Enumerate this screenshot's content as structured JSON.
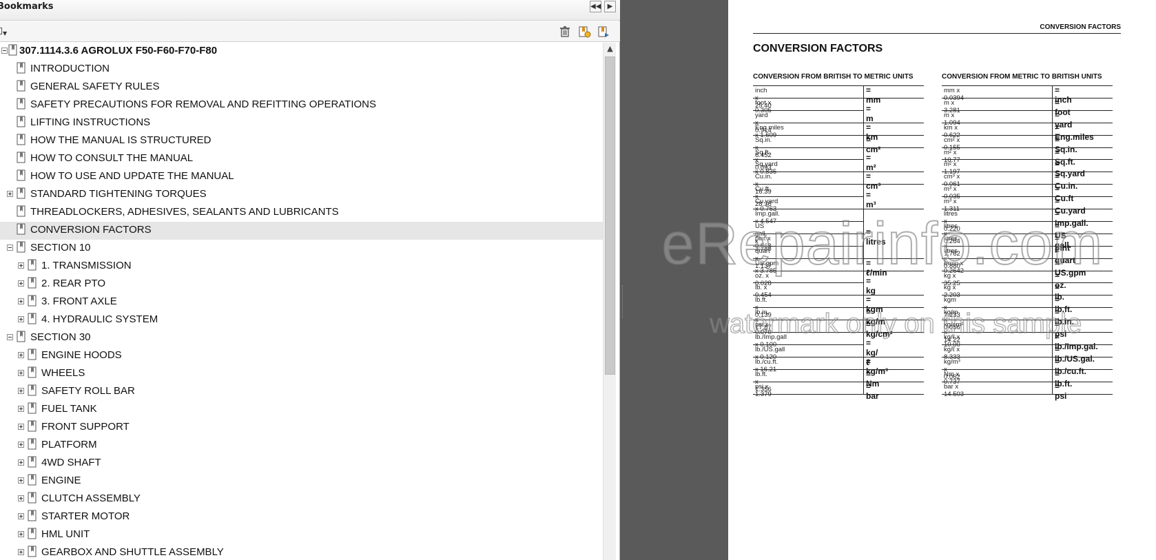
{
  "bookmarks_panel": {
    "title": "Bookmarks",
    "icons": {
      "collapse": "double-left-arrow-icon",
      "expand": "right-arrow-icon",
      "options": "options-dropdown-icon",
      "delete": "trash-icon",
      "new_bookmark": "new-bookmark-icon",
      "expand_bookmark": "expand-bookmark-icon"
    },
    "tree": [
      {
        "label": "307.1114.3.6 AGROLUX F50-F60-F70-F80",
        "level": 0,
        "expander": "minus",
        "bold": true
      },
      {
        "label": "INTRODUCTION",
        "level": 1,
        "expander": "none"
      },
      {
        "label": "GENERAL SAFETY RULES",
        "level": 1,
        "expander": "none"
      },
      {
        "label": "SAFETY PRECAUTIONS FOR REMOVAL AND REFITTING OPERATIONS",
        "level": 1,
        "expander": "none"
      },
      {
        "label": "LIFTING INSTRUCTIONS",
        "level": 1,
        "expander": "none"
      },
      {
        "label": "HOW THE MANUAL IS STRUCTURED",
        "level": 1,
        "expander": "none"
      },
      {
        "label": "HOW TO CONSULT THE MANUAL",
        "level": 1,
        "expander": "none"
      },
      {
        "label": "HOW TO USE AND UPDATE THE MANUAL",
        "level": 1,
        "expander": "none"
      },
      {
        "label": "STANDARD TIGHTENING TORQUES",
        "level": 1,
        "expander": "plus"
      },
      {
        "label": "THREADLOCKERS, ADHESIVES, SEALANTS AND LUBRICANTS",
        "level": 1,
        "expander": "none"
      },
      {
        "label": "CONVERSION FACTORS",
        "level": 1,
        "expander": "none",
        "selected": true
      },
      {
        "label": "SECTION 10",
        "level": 1,
        "expander": "minus"
      },
      {
        "label": "1. TRANSMISSION",
        "level": 2,
        "expander": "plus"
      },
      {
        "label": "2. REAR PTO",
        "level": 2,
        "expander": "plus"
      },
      {
        "label": "3. FRONT AXLE",
        "level": 2,
        "expander": "plus"
      },
      {
        "label": "4. HYDRAULIC SYSTEM",
        "level": 2,
        "expander": "plus"
      },
      {
        "label": "SECTION 30",
        "level": 1,
        "expander": "minus"
      },
      {
        "label": "ENGINE HOODS",
        "level": 2,
        "expander": "plus"
      },
      {
        "label": "WHEELS",
        "level": 2,
        "expander": "plus"
      },
      {
        "label": "SAFETY ROLL BAR",
        "level": 2,
        "expander": "plus"
      },
      {
        "label": "FUEL TANK",
        "level": 2,
        "expander": "plus"
      },
      {
        "label": "FRONT SUPPORT",
        "level": 2,
        "expander": "plus"
      },
      {
        "label": "PLATFORM",
        "level": 2,
        "expander": "plus"
      },
      {
        "label": "4WD SHAFT",
        "level": 2,
        "expander": "plus"
      },
      {
        "label": "ENGINE",
        "level": 2,
        "expander": "plus"
      },
      {
        "label": "CLUTCH ASSEMBLY",
        "level": 2,
        "expander": "plus"
      },
      {
        "label": "STARTER MOTOR",
        "level": 2,
        "expander": "plus"
      },
      {
        "label": "HML UNIT",
        "level": 2,
        "expander": "plus"
      },
      {
        "label": "GEARBOX AND SHUTTLE ASSEMBLY",
        "level": 2,
        "expander": "plus"
      }
    ]
  },
  "document": {
    "running_head": "CONVERSION FACTORS",
    "title": "CONVERSION FACTORS",
    "british_to_metric": {
      "heading": "CONVERSION FROM BRITISH TO METRIC UNITS",
      "rows": [
        "inch  x  25.40",
        "foot  x  0.305",
        "yard  x  0.914",
        "Eng.miles  x  1.609",
        "Sq.in.  x  6.452",
        "Sq.ft.  x  0.093",
        "Sq.yard  x  0.835",
        "Cu.in.  x  16.39",
        "Cu.ft.  x  28.36",
        "Cu.yard  x  0.763",
        "Imp.gall.  x  4.547",
        "US gall.  x  3.785",
        "pint  x  0.568",
        "quart  x  1.137",
        "US.gpm  x  3.785",
        "oz.  x  0.028",
        "lb.  x  0.454",
        "lb.ft.  x  0.139",
        "lb.in.  x  17.87",
        "psi  x  0.070",
        "lb./Imp.gall  x  0.100",
        "lb./US.gall  x  0.120",
        "lb./cu.ft.  x  16.21",
        "lb.ft.  x  1.356",
        "psi  x  1.379"
      ],
      "results": [
        {
          "text": "= mm",
          "start": 0,
          "span": 1
        },
        {
          "text": "= m",
          "start": 1,
          "span": 2
        },
        {
          "text": "= km",
          "start": 3,
          "span": 1
        },
        {
          "text": "= cm²",
          "start": 4,
          "span": 1
        },
        {
          "text": "= m²",
          "start": 5,
          "span": 2
        },
        {
          "text": "= cm³",
          "start": 7,
          "span": 1
        },
        {
          "text": "= m³",
          "start": 8,
          "span": 2
        },
        {
          "text": "= litres",
          "start": 10,
          "span": 4
        },
        {
          "text": "= ℓ/min",
          "start": 14,
          "span": 1
        },
        {
          "text": "= kg",
          "start": 15,
          "span": 2
        },
        {
          "text": "= kgm",
          "start": 17,
          "span": 1
        },
        {
          "text": "= kg/m",
          "start": 18,
          "span": 1
        },
        {
          "text": "= kg/cm²",
          "start": 19,
          "span": 1
        },
        {
          "text": "= kg/ℓ",
          "start": 20,
          "span": 2
        },
        {
          "text": "= kg/m³",
          "start": 22,
          "span": 1
        },
        {
          "text": "= Nm",
          "start": 23,
          "span": 1
        },
        {
          "text": "= bar",
          "start": 24,
          "span": 1
        }
      ]
    },
    "metric_to_british": {
      "heading": "CONVERSION FROM METRIC TO BRITISH UNITS",
      "rows": [
        "mm  x  0.0394",
        "m  x  3.281",
        "m  x  1.094",
        "km  x  0.622",
        "cm²  x  0.155",
        "m²  x  10.77",
        "m²  x  1.197",
        "cm³  x  0.061",
        "m³  x  0.035",
        "m³  x  1.311",
        "litres  x  0.220",
        "litres  x  0.264",
        "litres  x  1.762",
        "litres  x  0.880",
        "ℓ/min  x  0.2642",
        "kg  x  35.25",
        "kg  x  2.203",
        "kgm  x  7.233",
        "kg/m  x  0.056",
        "kg/cm²  x  14.22",
        "kg/ℓ  x  10.00",
        "kg/ℓ  x  8.333",
        "kg/m³  x  0.062",
        "Nm  x  0.737",
        "bar  x  14.503"
      ],
      "results": [
        "= inch",
        "= foot",
        "= yard",
        "= Eng.miles",
        "= Sq.in.",
        "= Sq.ft.",
        "= Sq.yard",
        "= Cu.in.",
        "= Cu.ft",
        "= Cu.yard",
        "= Imp.gall.",
        "= US gall.",
        "= pint",
        "= quart",
        "= US.gpm",
        "= oz.",
        "= lb.",
        "= lb.ft.",
        "= lb.in.",
        "= psi",
        "= lb./Imp.gal.",
        "= lb./US.gal.",
        "= lb./cu.ft.",
        "= lb.ft.",
        "= psi"
      ]
    }
  },
  "watermark": {
    "main": "eRepairinfo.com",
    "sub": "watermark only on this sample"
  }
}
